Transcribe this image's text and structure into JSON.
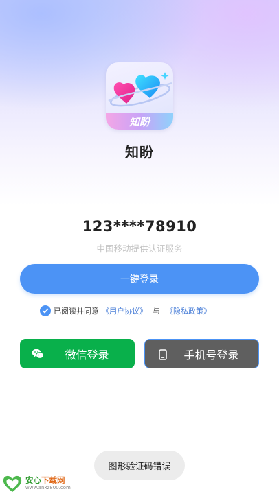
{
  "app": {
    "icon_text": "知盼",
    "name": "知盼"
  },
  "login": {
    "phone_masked": "123****78910",
    "provider_note": "中国移动提供认证服务",
    "one_click_label": "一键登录",
    "agreement": {
      "checked": true,
      "prefix": "已阅读并同意",
      "user_agreement": "《用户协议》",
      "and": "与",
      "privacy_policy": "《隐私政策》"
    },
    "wechat_label": "微信登录",
    "phone_label": "手机号登录"
  },
  "toast": {
    "message": "图形验证码错误"
  },
  "watermark": {
    "logo_text": "安心 知盼",
    "title_a": "安心",
    "title_b": "下载网",
    "url": "www.anxz800.com"
  },
  "colors": {
    "primary": "#4c93f5",
    "wechat": "#09b04b",
    "phone_button": "#5f5f5f",
    "link": "#4c80d8",
    "toast_bg": "#ececec"
  },
  "icons": {
    "app": "two-hearts-orbit-icon",
    "check": "check-icon",
    "wechat": "wechat-icon",
    "phone": "phone-icon"
  }
}
